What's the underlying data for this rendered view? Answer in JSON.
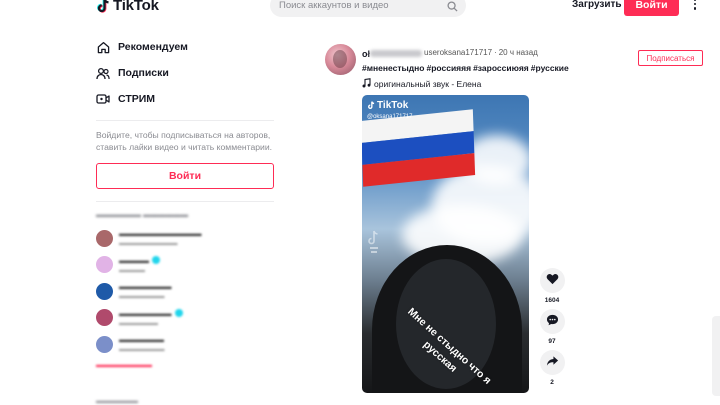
{
  "header": {
    "logo_text": "TikTok",
    "search_placeholder": "Поиск аккаунтов и видео",
    "upload_label": "Загрузить",
    "login_label": "Войти"
  },
  "sidebar": {
    "nav": [
      {
        "label": "Рекомендуем",
        "icon": "home-icon"
      },
      {
        "label": "Подписки",
        "icon": "users-icon"
      },
      {
        "label": "СТРИМ",
        "icon": "live-icon"
      }
    ],
    "hint": "Войдите, чтобы подписываться на авторов, ставить лайки видео и читать комментарии.",
    "login_label": "Войти"
  },
  "post": {
    "nickname": "useroksana171717",
    "separator": "·",
    "time": "20 ч назад",
    "hashtags": [
      "#мненестыдно",
      "#россияяя",
      "#зароссиюяя",
      "#русские"
    ],
    "music": "оригинальный звук - Елена",
    "follow_label": "Подписаться",
    "video": {
      "watermark_logo": "TikTok",
      "watermark_user": "@oksana171717",
      "overlay_text_line1": "Мне не стыдно что я",
      "overlay_text_line2": "русская"
    },
    "actions": {
      "likes": "1604",
      "comments": "97",
      "shares": "2"
    }
  },
  "colors": {
    "brand": "#fe2c55",
    "verified": "#20d5ec"
  }
}
